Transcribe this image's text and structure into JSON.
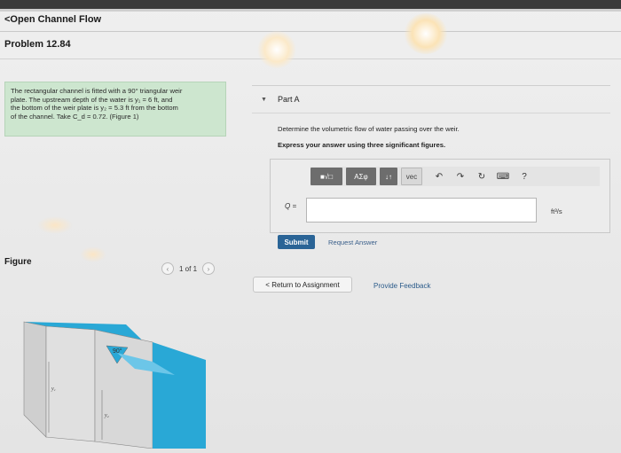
{
  "header": {
    "back_label": "<Open Channel Flow",
    "problem_title": "Problem 12.84"
  },
  "problem": {
    "statement_line1": "The rectangular channel is fitted with a 90° triangular weir",
    "statement_line2": "plate. The upstream depth of the water is y₁ = 6 ft, and",
    "statement_line3": "the bottom of the weir plate is y₂ = 5.3 ft from the bottom",
    "statement_line4": "of the channel. Take C_d = 0.72. (Figure 1)"
  },
  "figure": {
    "label": "Figure",
    "counter": "1 of 1",
    "prev_icon": "chevron-left-icon",
    "next_icon": "chevron-right-icon",
    "angle_label": "90°",
    "y1_label": "y₁",
    "y2_label": "y₂",
    "water_color": "#29a8d6",
    "wall_color": "#d9d9d9"
  },
  "partA": {
    "title": "Part A",
    "question": "Determine the volumetric flow of water passing over the weir.",
    "instruction": "Express your answer using three significant figures.",
    "toolbar": {
      "templates": "■√□",
      "greek": "ΑΣφ",
      "arrows": "↓↑",
      "vec": "vec",
      "undo": "↶",
      "redo": "↷",
      "reset": "↻",
      "keyboard": "⌨",
      "help": "?"
    },
    "answer_label": "Q =",
    "answer_value": "",
    "unit": "ft³/s",
    "submit_label": "Submit",
    "request_label": "Request Answer"
  },
  "footer": {
    "return_label": "< Return to Assignment",
    "feedback_label": "Provide Feedback"
  },
  "colors": {
    "accent": "#2a6496",
    "problem_bg": "#cde6cf"
  }
}
